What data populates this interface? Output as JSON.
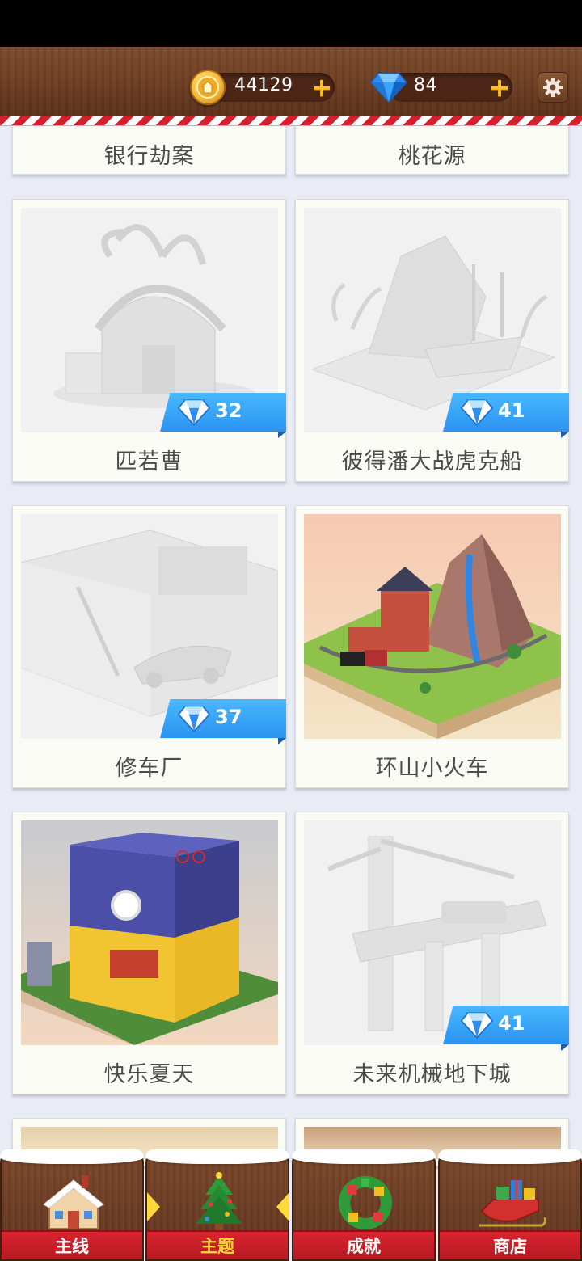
{
  "header": {
    "coins": "44129",
    "gems": "84"
  },
  "top_row": [
    {
      "title": "银行劫案"
    },
    {
      "title": "桃花源"
    }
  ],
  "cards": [
    {
      "title": "匹若曹",
      "price": "32",
      "locked": true
    },
    {
      "title": "彼得潘大战虎克船",
      "price": "41",
      "locked": true
    },
    {
      "title": "修车厂",
      "price": "37",
      "locked": true
    },
    {
      "title": "环山小火车",
      "locked": false
    },
    {
      "title": "快乐夏天",
      "locked": false
    },
    {
      "title": "未来机械地下城",
      "price": "41",
      "locked": true
    }
  ],
  "nav": {
    "tabs": [
      {
        "label": "主线",
        "icon": "gingerbread-house-icon"
      },
      {
        "label": "主题",
        "icon": "christmas-tree-icon",
        "active": true
      },
      {
        "label": "成就",
        "icon": "wreath-icon"
      },
      {
        "label": "商店",
        "icon": "sleigh-gifts-icon"
      }
    ]
  },
  "colors": {
    "wood": "#6c3d22",
    "gem_blue": "#2a93f0",
    "nav_red": "#c41f29",
    "active_label": "#ffd93a"
  }
}
